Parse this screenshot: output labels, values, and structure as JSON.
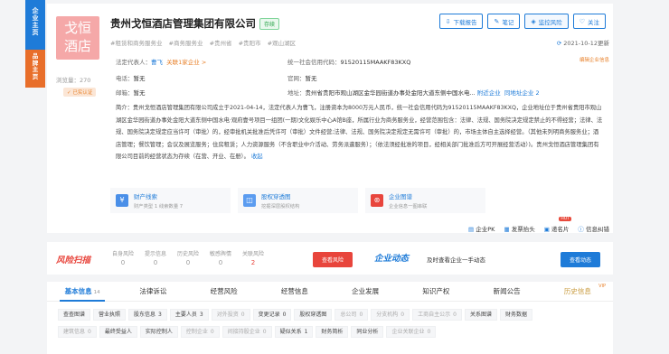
{
  "sidebar": {
    "tab1": [
      "企",
      "业",
      "主",
      "页"
    ],
    "tab2": [
      "品",
      "牌",
      "主",
      "页"
    ]
  },
  "company": {
    "logo_line1": "戈恒",
    "logo_line2": "酒店",
    "name": "贵州戈恒酒店管理集团有限公司",
    "status": "存续",
    "tags": [
      "#租赁和商务服务业",
      "#商务服务业",
      "#贵州省",
      "#贵阳市",
      "#观山湖区"
    ],
    "views_label": "浏览量：270",
    "certified_label": "已实认证",
    "updated": "2021-10-12更新",
    "edit_link": "编辑企业信息"
  },
  "actions": {
    "report": "下载报告",
    "notes": "笔记",
    "monitor": "监控风险",
    "follow": "关注"
  },
  "info": {
    "legal_label": "法定代表人：",
    "legal_value": "曹飞",
    "related": "关联1家企业 >",
    "phone_label": "电话：",
    "phone_value": "暂无",
    "email_label": "邮箱：",
    "email_value": "暂无",
    "credit_label": "统一社会信用代码：",
    "credit_value": "91520115MAAKF83KXQ",
    "site_label": "官网：",
    "site_value": "暂无",
    "address_label": "地址：",
    "address_value": "贵州省贵阳市观山湖区金华园街道办事处金阳大道东侧中国水电...",
    "nearby": "附近企业",
    "same_addr": "同地址企业 2"
  },
  "intro": {
    "text": "简介：贵州戈恒酒店管理集团有限公司成立于2021-04-14，法定代表人为曹飞，注册资本为8000万元人民币，统一社会信用代码为91520115MAAKF83KXQ，企业地址位于贵州省贵阳市观山湖区金华园街道办事处金阳大道东侧中国水电·观府壹号项目一组团(一期)文化娱乐中心A馆B座，所属行业为商务服务业，经营范围包含：法律、法规、国务院决定规定禁止的不得经营；法律、法规、国务院决定规定应当许可（审批）的，经审批机关批准后凭许可（审批）文件经营;法律、法规、国务院决定规定无需许可（审批）的，市场主体自主选择经营。（其他未列明商务服务业；酒店管理；餐饮管理；会议及展览服务；住房租赁；人力资源服务（不含职业中介活动、劳务派遣服务）；（依法须经批准的项目，经相关部门批准后方可开展经营活动）)。贵州戈恒酒店管理集团有限公司目前的经营状态为存续（在营、开业、在册）。",
    "collapse": "收起"
  },
  "features": [
    {
      "title": "财产线索",
      "sub": "财产类型 1  线索数量 7"
    },
    {
      "title": "股权穿透图",
      "sub": "挖掘深层股权结构"
    },
    {
      "title": "企业图谱",
      "sub": "企业信息一图串联"
    }
  ],
  "tools": {
    "pk": "企业PK",
    "tracking": "发票抬头",
    "card": "递名片",
    "hot": "HOT",
    "correct": "信息纠错"
  },
  "risk": {
    "logo": "风险扫描",
    "items": [
      {
        "label": "自身风险",
        "value": "0"
      },
      {
        "label": "提示信息",
        "value": "0"
      },
      {
        "label": "历史风险",
        "value": "0"
      },
      {
        "label": "敏感舆情",
        "value": "0"
      },
      {
        "label": "关联风险",
        "value": "2"
      }
    ],
    "button": "查看风险",
    "dyn_logo": "企业动态",
    "dyn_text": "及时查看企业一手动态",
    "dyn_button": "查看动态"
  },
  "tabs": [
    {
      "label": "基本信息",
      "count": "14"
    },
    {
      "label": "法律诉讼",
      "count": ""
    },
    {
      "label": "经营风险",
      "count": ""
    },
    {
      "label": "经营信息",
      "count": ""
    },
    {
      "label": "企业发展",
      "count": ""
    },
    {
      "label": "知识产权",
      "count": ""
    },
    {
      "label": "新闻公告",
      "count": ""
    },
    {
      "label": "历史信息",
      "count": ""
    }
  ],
  "vip": "VIP",
  "subtabs_row1": [
    {
      "label": "查查图谱",
      "count": ""
    },
    {
      "label": "营业执照",
      "count": ""
    },
    {
      "label": "股东信息",
      "count": "3"
    },
    {
      "label": "主要人员",
      "count": "3"
    },
    {
      "label": "对外投资",
      "count": "0"
    },
    {
      "label": "变更记录",
      "count": "0"
    },
    {
      "label": "股权穿透图",
      "count": ""
    },
    {
      "label": "总公司",
      "count": "0"
    },
    {
      "label": "分支机构",
      "count": "0"
    },
    {
      "label": "工商自主公示",
      "count": "0"
    },
    {
      "label": "关系图谱",
      "count": ""
    },
    {
      "label": "财务数据",
      "count": ""
    }
  ],
  "subtabs_row2": [
    {
      "label": "建筑信息",
      "count": "0"
    },
    {
      "label": "最终受益人",
      "count": ""
    },
    {
      "label": "实际控制人",
      "count": ""
    },
    {
      "label": "控制企业",
      "count": "0"
    },
    {
      "label": "间接持股企业",
      "count": "0"
    },
    {
      "label": "疑似关系",
      "count": "1"
    },
    {
      "label": "财务简析",
      "count": ""
    },
    {
      "label": "同业分析",
      "count": ""
    },
    {
      "label": "企业关联企业",
      "count": "0"
    }
  ],
  "colors": {
    "primary": "#1e7bd8",
    "accent": "#e86e2a",
    "danger": "#e8453c",
    "success": "#2aa34a"
  }
}
